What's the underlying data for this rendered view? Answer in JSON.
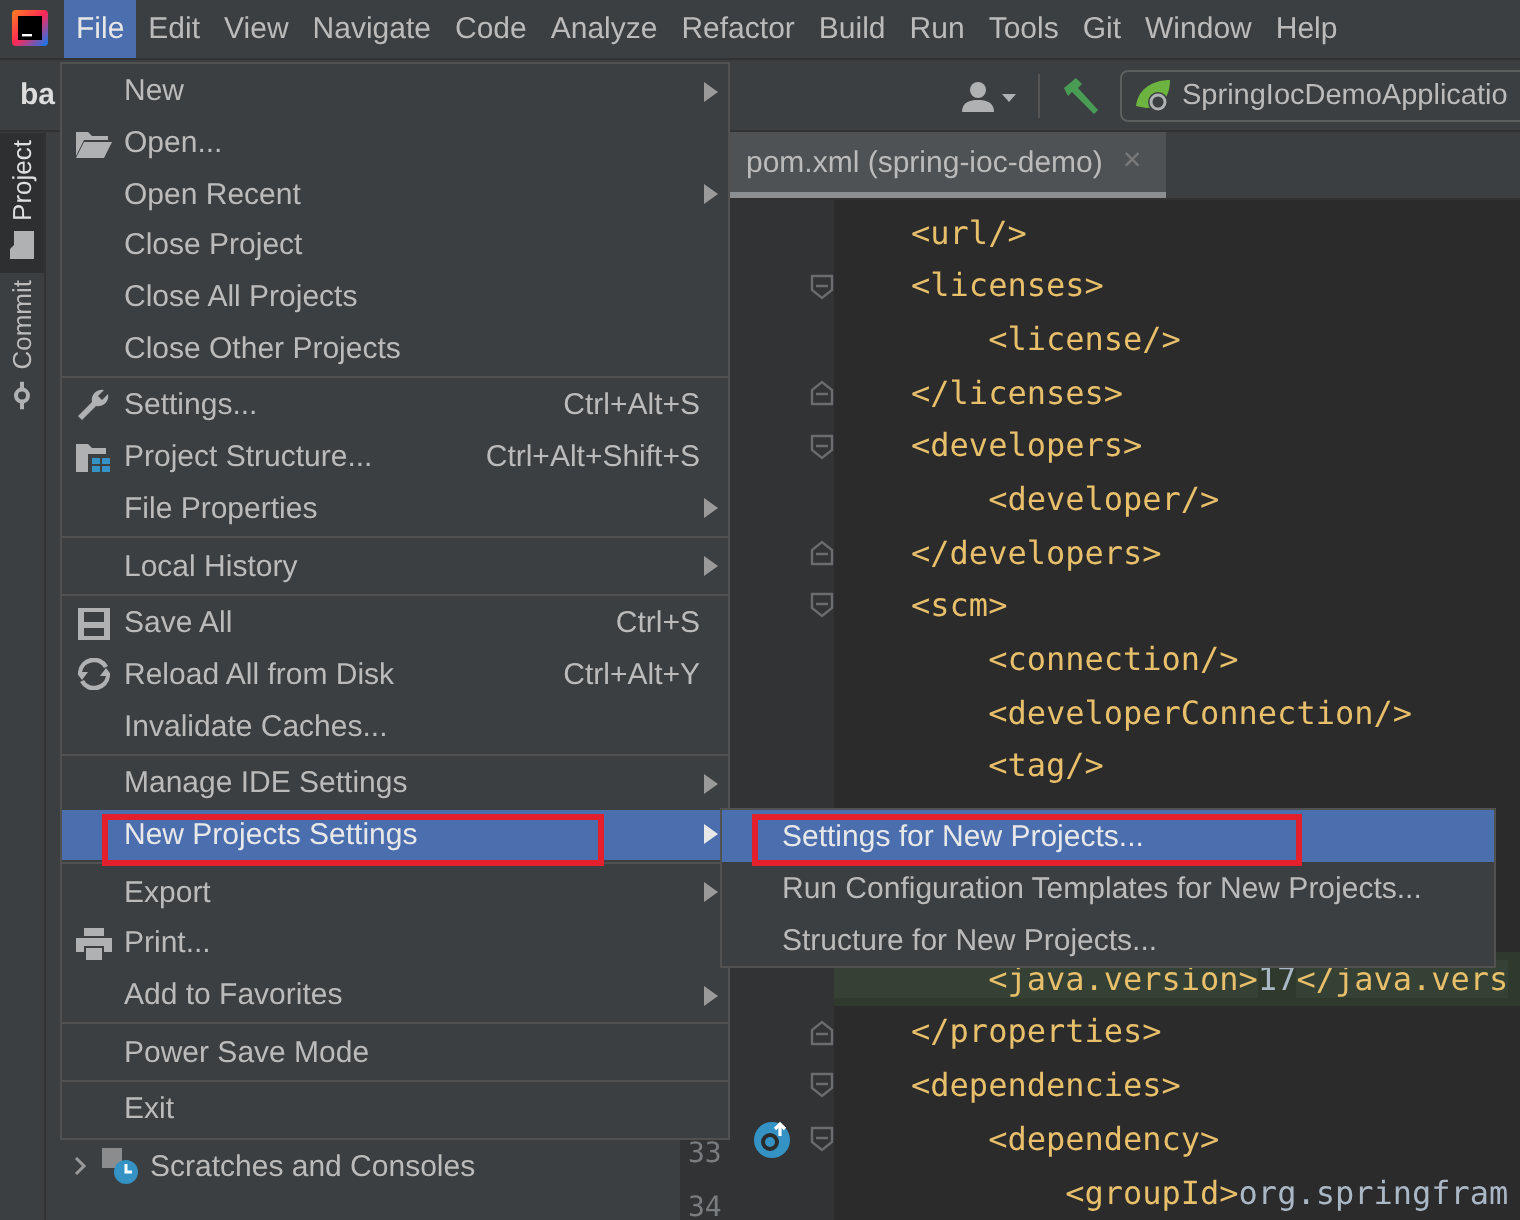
{
  "menubar": [
    {
      "label": "File",
      "selected": true
    },
    {
      "label": "Edit",
      "selected": false
    },
    {
      "label": "View",
      "selected": false
    },
    {
      "label": "Navigate",
      "selected": false
    },
    {
      "label": "Code",
      "selected": false
    },
    {
      "label": "Analyze",
      "selected": false
    },
    {
      "label": "Refactor",
      "selected": false
    },
    {
      "label": "Build",
      "selected": false
    },
    {
      "label": "Run",
      "selected": false
    },
    {
      "label": "Tools",
      "selected": false
    },
    {
      "label": "Git",
      "selected": false
    },
    {
      "label": "Window",
      "selected": false
    },
    {
      "label": "Help",
      "selected": false
    }
  ],
  "toolbar": {
    "breadcrumb": "ba",
    "run_configuration": "SpringIocDemoApplicatio"
  },
  "tool_strip": [
    {
      "label": "Project",
      "selected": true
    },
    {
      "label": "Commit",
      "selected": false
    }
  ],
  "project_tree": [
    {
      "label": "Scratches and Consoles",
      "expanded": false
    }
  ],
  "editor": {
    "tabs": [
      {
        "label": "pom.xml (spring-ioc-demo)",
        "close": "×",
        "selected": true
      }
    ],
    "lines_above": [
      {
        "segments": [
          {
            "kind": "tag",
            "text": "    <url/>"
          }
        ],
        "highlighted": false
      },
      {
        "segments": [
          {
            "kind": "tag",
            "text": "    <licenses>"
          }
        ],
        "highlighted": false,
        "fold_start": true
      },
      {
        "segments": [
          {
            "kind": "tag",
            "text": "        <license/>"
          }
        ],
        "highlighted": false
      },
      {
        "segments": [
          {
            "kind": "tag",
            "text": "    </licenses>"
          }
        ],
        "highlighted": false,
        "fold_end": true
      },
      {
        "segments": [
          {
            "kind": "tag",
            "text": "    <developers>"
          }
        ],
        "highlighted": false,
        "fold_start": true
      },
      {
        "segments": [
          {
            "kind": "tag",
            "text": "        <developer/>"
          }
        ],
        "highlighted": false
      },
      {
        "segments": [
          {
            "kind": "tag",
            "text": "    </developers>"
          }
        ],
        "highlighted": false,
        "fold_end": true
      },
      {
        "segments": [
          {
            "kind": "tag",
            "text": "    <scm>"
          }
        ],
        "highlighted": false,
        "fold_start": true
      },
      {
        "segments": [
          {
            "kind": "tag",
            "text": "        <connection/>"
          }
        ],
        "highlighted": false
      },
      {
        "segments": [
          {
            "kind": "tag",
            "text": "        <developerConnection/>"
          }
        ],
        "highlighted": false
      },
      {
        "segments": [
          {
            "kind": "tag",
            "text": "        <tag/>"
          }
        ],
        "highlighted": false
      }
    ],
    "lines_below": [
      {
        "segments": [
          {
            "kind": "tag",
            "text": "        <java.version>"
          },
          {
            "kind": "value",
            "text": "17"
          },
          {
            "kind": "tag",
            "text": "</java.vers"
          }
        ],
        "highlighted": true
      },
      {
        "segments": [
          {
            "kind": "tag",
            "text": "    </properties>"
          }
        ],
        "highlighted": false,
        "fold_end": true
      },
      {
        "segments": [
          {
            "kind": "tag",
            "text": "    <dependencies>"
          }
        ],
        "highlighted": false,
        "fold_start": true
      },
      {
        "line_number": "33",
        "segments": [
          {
            "kind": "tag",
            "text": "        <dependency>"
          }
        ],
        "highlighted": false,
        "fold_start": true,
        "marker": true
      },
      {
        "line_number": "34",
        "segments": [
          {
            "kind": "tag",
            "text": "            <groupId>"
          },
          {
            "kind": "value",
            "text": "org.springfram"
          }
        ],
        "highlighted": false
      }
    ]
  },
  "file_menu": {
    "groups": [
      [
        {
          "label": "New",
          "submenu": true,
          "selected": false
        },
        {
          "label": "Open...",
          "submenu": false,
          "selected": false
        },
        {
          "label": "Open Recent",
          "submenu": true,
          "selected": false
        },
        {
          "label": "Close Project",
          "submenu": false,
          "selected": false
        },
        {
          "label": "Close All Projects",
          "submenu": false,
          "selected": false
        },
        {
          "label": "Close Other Projects",
          "submenu": false,
          "selected": false
        }
      ],
      [
        {
          "label": "Settings...",
          "shortcut": "Ctrl+Alt+S",
          "submenu": false,
          "selected": false
        },
        {
          "label": "Project Structure...",
          "shortcut": "Ctrl+Alt+Shift+S",
          "submenu": false,
          "selected": false
        },
        {
          "label": "File Properties",
          "submenu": true,
          "selected": false
        }
      ],
      [
        {
          "label": "Local History",
          "submenu": true,
          "selected": false
        }
      ],
      [
        {
          "label": "Save All",
          "shortcut": "Ctrl+S",
          "submenu": false,
          "selected": false
        },
        {
          "label": "Reload All from Disk",
          "shortcut": "Ctrl+Alt+Y",
          "submenu": false,
          "selected": false
        },
        {
          "label": "Invalidate Caches...",
          "submenu": false,
          "selected": false
        }
      ],
      [
        {
          "label": "Manage IDE Settings",
          "submenu": true,
          "selected": false
        },
        {
          "label": "New Projects Settings",
          "submenu": true,
          "selected": true,
          "framed": true
        }
      ],
      [
        {
          "label": "Export",
          "submenu": true,
          "selected": false
        },
        {
          "label": "Print...",
          "submenu": false,
          "selected": false
        },
        {
          "label": "Add to Favorites",
          "submenu": true,
          "selected": false
        }
      ],
      [
        {
          "label": "Power Save Mode",
          "submenu": false,
          "selected": false
        }
      ],
      [
        {
          "label": "Exit",
          "submenu": false,
          "selected": false
        }
      ]
    ]
  },
  "submenu": [
    {
      "label": "Settings for New Projects...",
      "selected": true,
      "framed": true
    },
    {
      "label": "Run Configuration Templates for New Projects...",
      "selected": false
    },
    {
      "label": "Structure for New Projects...",
      "selected": false
    }
  ]
}
